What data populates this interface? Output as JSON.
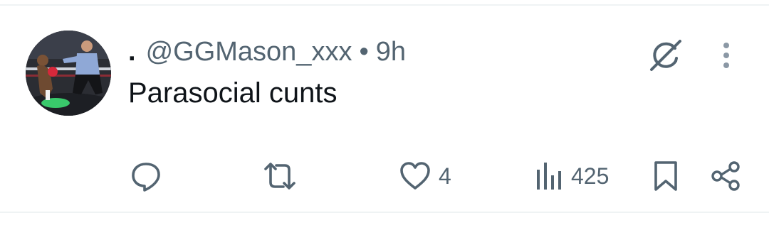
{
  "post": {
    "display_name": ".",
    "handle": "@GGMason_xxx",
    "separator": "•",
    "time": "9h",
    "text": "Parasocial cunts"
  },
  "actions": {
    "reply": {
      "icon": "reply-icon",
      "count": ""
    },
    "repost": {
      "icon": "repost-icon",
      "count": ""
    },
    "like": {
      "icon": "heart-icon",
      "count": "4"
    },
    "views": {
      "icon": "views-icon",
      "count": "425"
    },
    "bookmark": {
      "icon": "bookmark-icon"
    },
    "share": {
      "icon": "share-icon"
    }
  },
  "header_icons": [
    "grok-icon",
    "more-vertical-icon"
  ],
  "colors": {
    "text_primary": "#0f1419",
    "text_secondary": "#536471",
    "divider": "#eff3f4",
    "background": "#ffffff"
  }
}
